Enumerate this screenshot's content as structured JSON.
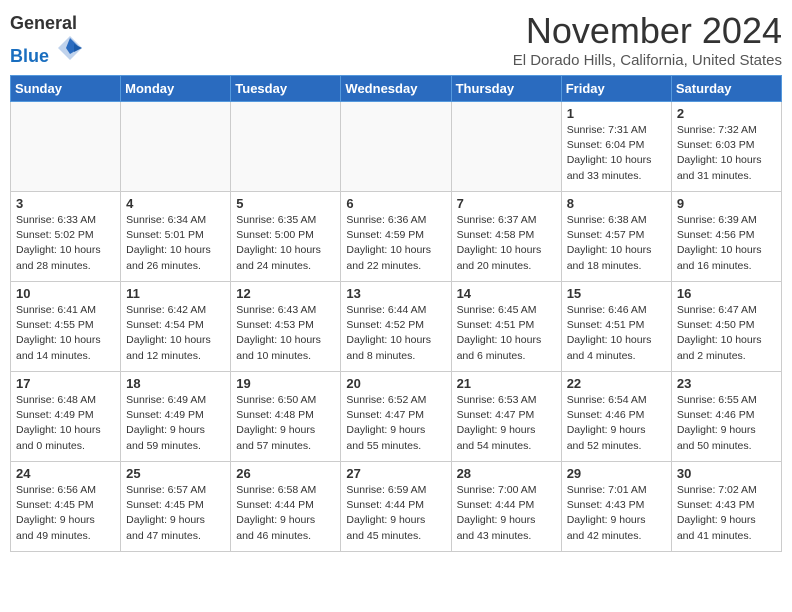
{
  "header": {
    "logo_line1": "General",
    "logo_line2": "Blue",
    "title": "November 2024",
    "subtitle": "El Dorado Hills, California, United States"
  },
  "weekdays": [
    "Sunday",
    "Monday",
    "Tuesday",
    "Wednesday",
    "Thursday",
    "Friday",
    "Saturday"
  ],
  "weeks": [
    [
      {
        "day": "",
        "info": ""
      },
      {
        "day": "",
        "info": ""
      },
      {
        "day": "",
        "info": ""
      },
      {
        "day": "",
        "info": ""
      },
      {
        "day": "",
        "info": ""
      },
      {
        "day": "1",
        "info": "Sunrise: 7:31 AM\nSunset: 6:04 PM\nDaylight: 10 hours\nand 33 minutes."
      },
      {
        "day": "2",
        "info": "Sunrise: 7:32 AM\nSunset: 6:03 PM\nDaylight: 10 hours\nand 31 minutes."
      }
    ],
    [
      {
        "day": "3",
        "info": "Sunrise: 6:33 AM\nSunset: 5:02 PM\nDaylight: 10 hours\nand 28 minutes."
      },
      {
        "day": "4",
        "info": "Sunrise: 6:34 AM\nSunset: 5:01 PM\nDaylight: 10 hours\nand 26 minutes."
      },
      {
        "day": "5",
        "info": "Sunrise: 6:35 AM\nSunset: 5:00 PM\nDaylight: 10 hours\nand 24 minutes."
      },
      {
        "day": "6",
        "info": "Sunrise: 6:36 AM\nSunset: 4:59 PM\nDaylight: 10 hours\nand 22 minutes."
      },
      {
        "day": "7",
        "info": "Sunrise: 6:37 AM\nSunset: 4:58 PM\nDaylight: 10 hours\nand 20 minutes."
      },
      {
        "day": "8",
        "info": "Sunrise: 6:38 AM\nSunset: 4:57 PM\nDaylight: 10 hours\nand 18 minutes."
      },
      {
        "day": "9",
        "info": "Sunrise: 6:39 AM\nSunset: 4:56 PM\nDaylight: 10 hours\nand 16 minutes."
      }
    ],
    [
      {
        "day": "10",
        "info": "Sunrise: 6:41 AM\nSunset: 4:55 PM\nDaylight: 10 hours\nand 14 minutes."
      },
      {
        "day": "11",
        "info": "Sunrise: 6:42 AM\nSunset: 4:54 PM\nDaylight: 10 hours\nand 12 minutes."
      },
      {
        "day": "12",
        "info": "Sunrise: 6:43 AM\nSunset: 4:53 PM\nDaylight: 10 hours\nand 10 minutes."
      },
      {
        "day": "13",
        "info": "Sunrise: 6:44 AM\nSunset: 4:52 PM\nDaylight: 10 hours\nand 8 minutes."
      },
      {
        "day": "14",
        "info": "Sunrise: 6:45 AM\nSunset: 4:51 PM\nDaylight: 10 hours\nand 6 minutes."
      },
      {
        "day": "15",
        "info": "Sunrise: 6:46 AM\nSunset: 4:51 PM\nDaylight: 10 hours\nand 4 minutes."
      },
      {
        "day": "16",
        "info": "Sunrise: 6:47 AM\nSunset: 4:50 PM\nDaylight: 10 hours\nand 2 minutes."
      }
    ],
    [
      {
        "day": "17",
        "info": "Sunrise: 6:48 AM\nSunset: 4:49 PM\nDaylight: 10 hours\nand 0 minutes."
      },
      {
        "day": "18",
        "info": "Sunrise: 6:49 AM\nSunset: 4:49 PM\nDaylight: 9 hours\nand 59 minutes."
      },
      {
        "day": "19",
        "info": "Sunrise: 6:50 AM\nSunset: 4:48 PM\nDaylight: 9 hours\nand 57 minutes."
      },
      {
        "day": "20",
        "info": "Sunrise: 6:52 AM\nSunset: 4:47 PM\nDaylight: 9 hours\nand 55 minutes."
      },
      {
        "day": "21",
        "info": "Sunrise: 6:53 AM\nSunset: 4:47 PM\nDaylight: 9 hours\nand 54 minutes."
      },
      {
        "day": "22",
        "info": "Sunrise: 6:54 AM\nSunset: 4:46 PM\nDaylight: 9 hours\nand 52 minutes."
      },
      {
        "day": "23",
        "info": "Sunrise: 6:55 AM\nSunset: 4:46 PM\nDaylight: 9 hours\nand 50 minutes."
      }
    ],
    [
      {
        "day": "24",
        "info": "Sunrise: 6:56 AM\nSunset: 4:45 PM\nDaylight: 9 hours\nand 49 minutes."
      },
      {
        "day": "25",
        "info": "Sunrise: 6:57 AM\nSunset: 4:45 PM\nDaylight: 9 hours\nand 47 minutes."
      },
      {
        "day": "26",
        "info": "Sunrise: 6:58 AM\nSunset: 4:44 PM\nDaylight: 9 hours\nand 46 minutes."
      },
      {
        "day": "27",
        "info": "Sunrise: 6:59 AM\nSunset: 4:44 PM\nDaylight: 9 hours\nand 45 minutes."
      },
      {
        "day": "28",
        "info": "Sunrise: 7:00 AM\nSunset: 4:44 PM\nDaylight: 9 hours\nand 43 minutes."
      },
      {
        "day": "29",
        "info": "Sunrise: 7:01 AM\nSunset: 4:43 PM\nDaylight: 9 hours\nand 42 minutes."
      },
      {
        "day": "30",
        "info": "Sunrise: 7:02 AM\nSunset: 4:43 PM\nDaylight: 9 hours\nand 41 minutes."
      }
    ]
  ]
}
